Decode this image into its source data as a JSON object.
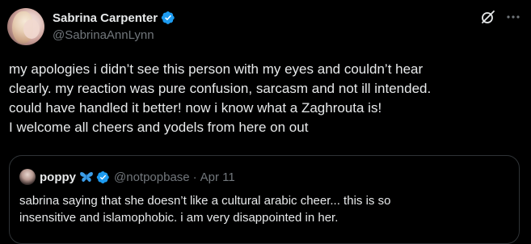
{
  "post": {
    "author": {
      "display_name": "Sabrina Carpenter",
      "handle": "@SabrinaAnnLynn",
      "verified": true
    },
    "text_lines": [
      "my apologies i didn’t see this person with my eyes and couldn’t hear",
      "clearly. my reaction was pure confusion, sarcasm and not ill intended.",
      "could have handled it better! now i know what a Zaghrouta is!",
      "I welcome all cheers and yodels from here on out"
    ],
    "actions": {
      "grok_icon": "grok-icon",
      "more_icon": "more-icon"
    }
  },
  "quote": {
    "author": {
      "display_name": "poppy",
      "emoji": "butterfly",
      "verified": true,
      "handle": "@notpopbase",
      "separator": "·",
      "date": "Apr 11"
    },
    "text_lines": [
      "sabrina saying that she doesn’t like a cultural arabic cheer... this is so",
      "insensitive and islamophobic. i am very disappointed in her."
    ]
  },
  "colors": {
    "background": "#000000",
    "primary_text": "#e7e9ea",
    "secondary_text": "#71767b",
    "verified_blue": "#1d9bf0",
    "border": "#2f3336"
  }
}
